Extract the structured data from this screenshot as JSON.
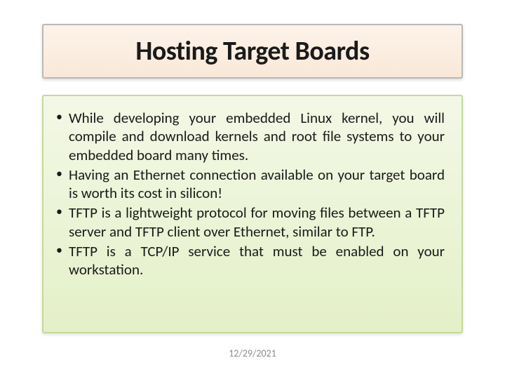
{
  "title": "Hosting Target Boards",
  "bullets": [
    "While developing your embedded Linux kernel, you will compile and download kernels and root file systems to your embedded board many times.",
    "Having an Ethernet connection available on your target board is worth its cost in silicon!",
    "TFTP is a lightweight protocol for moving files between a TFTP server and TFTP client over Ethernet, similar to FTP.",
    "TFTP is a TCP/IP service that must be enabled on your workstation."
  ],
  "footer_date": "12/29/2021"
}
